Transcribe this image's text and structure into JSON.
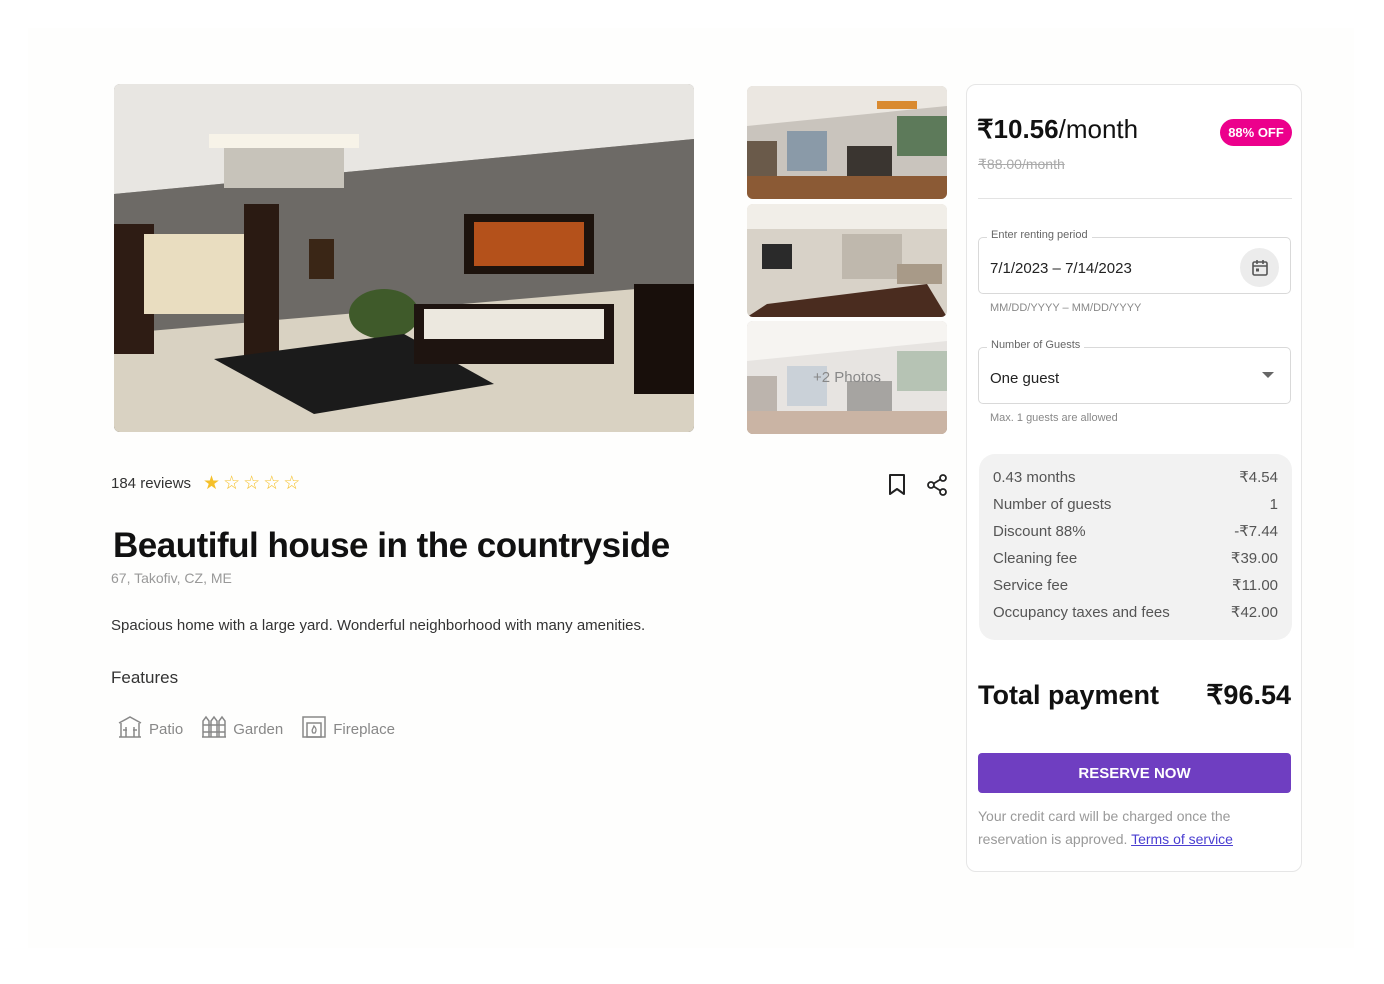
{
  "listing": {
    "reviews_label": "184 reviews",
    "rating": 1,
    "rating_max": 5,
    "title": "Beautiful house in the countryside",
    "address": "67, Takofiv, CZ, ME",
    "description": "Spacious home with a large yard. Wonderful neighborhood with many amenities.",
    "features_heading": "Features",
    "features": [
      {
        "label": "Patio",
        "icon": "patio-icon"
      },
      {
        "label": "Garden",
        "icon": "garden-icon"
      },
      {
        "label": "Fireplace",
        "icon": "fireplace-icon"
      }
    ],
    "more_photos_label": "+2 Photos"
  },
  "booking": {
    "price": "₹10.56",
    "price_unit": "/month",
    "old_price": "₹88.00/month",
    "discount_badge": "88% OFF",
    "period_label": "Enter renting period",
    "period_value": "7/1/2023 – 7/14/2023",
    "period_helper": "MM/DD/YYYY – MM/DD/YYYY",
    "guests_label": "Number of Guests",
    "guests_value": "One guest",
    "guests_helper": "Max. 1 guests are allowed",
    "breakdown": [
      {
        "label": "0.43 months",
        "value": "₹4.54"
      },
      {
        "label": "Number of guests",
        "value": "1"
      },
      {
        "label": "Discount 88%",
        "value": "-₹7.44"
      },
      {
        "label": "Cleaning fee",
        "value": "₹39.00"
      },
      {
        "label": "Service fee",
        "value": "₹11.00"
      },
      {
        "label": "Occupancy taxes and fees",
        "value": "₹42.00"
      }
    ],
    "total_label": "Total payment",
    "total_value": "₹96.54",
    "reserve_label": "RESERVE NOW",
    "note": "Your credit card will be charged once the reservation is approved.",
    "terms_link": "Terms of service"
  },
  "colors": {
    "accent": "#6f3ec1",
    "badge": "#ec008c",
    "star": "#f5c02a",
    "link": "#4a3ed1"
  }
}
